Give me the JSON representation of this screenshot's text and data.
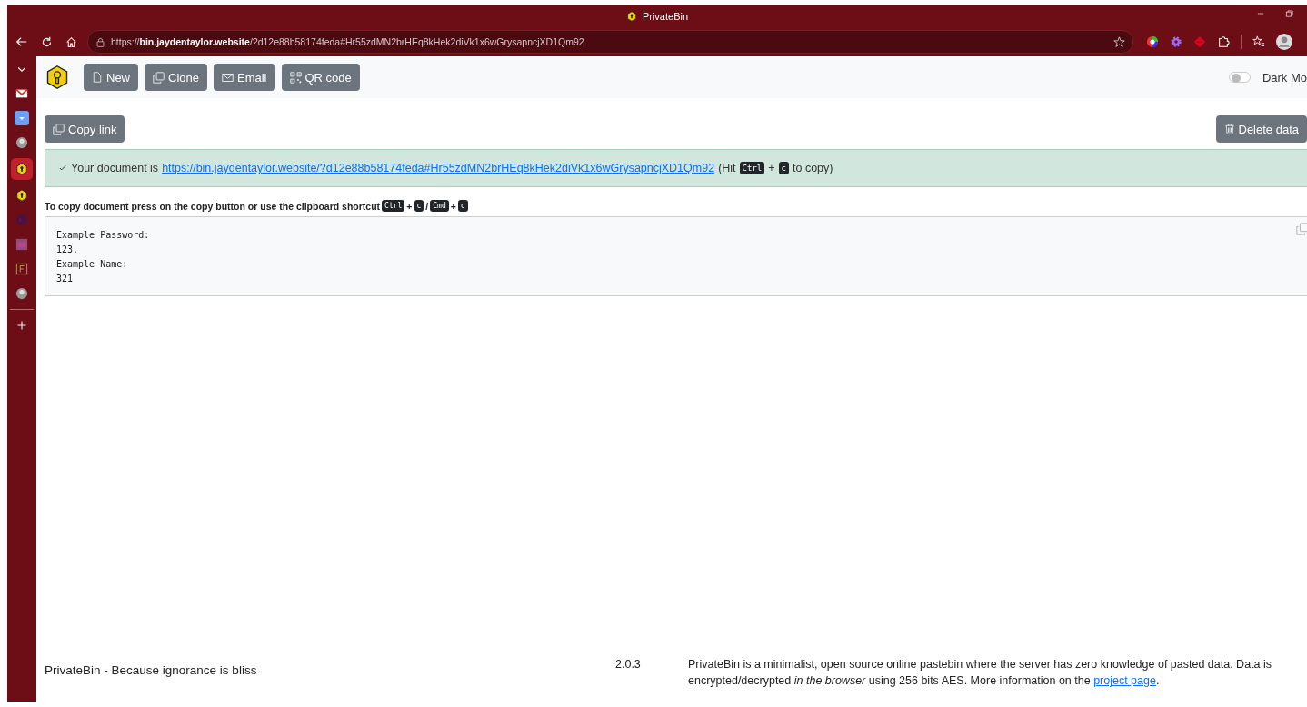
{
  "window": {
    "title": "PrivateBin"
  },
  "address_bar": {
    "scheme": "https://",
    "host": "bin.jaydentaylor.website",
    "path": "/?d12e88b58174feda#Hr55zdMN2brHEq8kHek2diVk1x6wGrysapncjXD1Qm92"
  },
  "sidebar": {
    "items": [
      {
        "kind": "chevron",
        "selected": false
      },
      {
        "kind": "mail",
        "selected": false
      },
      {
        "kind": "download",
        "selected": false
      },
      {
        "kind": "avatar",
        "selected": false
      },
      {
        "kind": "bin",
        "selected": true
      },
      {
        "kind": "bin",
        "selected": false
      },
      {
        "kind": "terminal",
        "selected": false
      },
      {
        "kind": "calendar",
        "selected": false
      },
      {
        "kind": "form",
        "selected": false
      },
      {
        "kind": "avatar",
        "selected": false
      },
      {
        "kind": "plus",
        "selected": false
      }
    ]
  },
  "toolbar": {
    "buttons": [
      {
        "kind": "file",
        "label": "New"
      },
      {
        "kind": "clone",
        "label": "Clone"
      },
      {
        "kind": "mail",
        "label": "Email"
      },
      {
        "kind": "qr",
        "label": "QR code"
      }
    ],
    "dark_mode": {
      "label": "Dark Mo",
      "on": false
    }
  },
  "actions": {
    "copy_link": "Copy link",
    "delete": "Delete data"
  },
  "alert": {
    "parts": [
      {
        "kind": "text",
        "text": "Your document is"
      },
      {
        "kind": "link",
        "text": "https://bin.jaydentaylor.website/?d12e88b58174feda#Hr55zdMN2brHEq8kHek2diVk1x6wGrysapncjXD1Qm92"
      },
      {
        "kind": "text",
        "text": "(Hit"
      },
      {
        "kind": "key",
        "text": "Ctrl"
      },
      {
        "kind": "sep",
        "text": "+"
      },
      {
        "kind": "key",
        "text": "c"
      },
      {
        "kind": "text",
        "text": "to copy)"
      }
    ]
  },
  "hint": {
    "parts": [
      {
        "kind": "text",
        "text": "To copy document press on the copy button or use the clipboard shortcut"
      },
      {
        "kind": "key",
        "text": "Ctrl"
      },
      {
        "kind": "sep",
        "text": "+"
      },
      {
        "kind": "key",
        "text": "c"
      },
      {
        "kind": "sep",
        "text": "/"
      },
      {
        "kind": "key",
        "text": "Cmd"
      },
      {
        "kind": "sep",
        "text": "+"
      },
      {
        "kind": "key",
        "text": "c"
      }
    ]
  },
  "document": {
    "lines": [
      "Example Password:",
      "123.",
      "Example Name:",
      "321"
    ]
  },
  "footer": {
    "name": "PrivateBin",
    "tagline": "- Because ignorance is bliss",
    "version": "2.0.3",
    "about": "PrivateBin is a minimalist, open source online pastebin where the server has zero knowledge of pasted data. Data is encrypted/decrypted *in the browser* using 256 bits AES. More information on the",
    "link": "project page",
    "end": "."
  }
}
